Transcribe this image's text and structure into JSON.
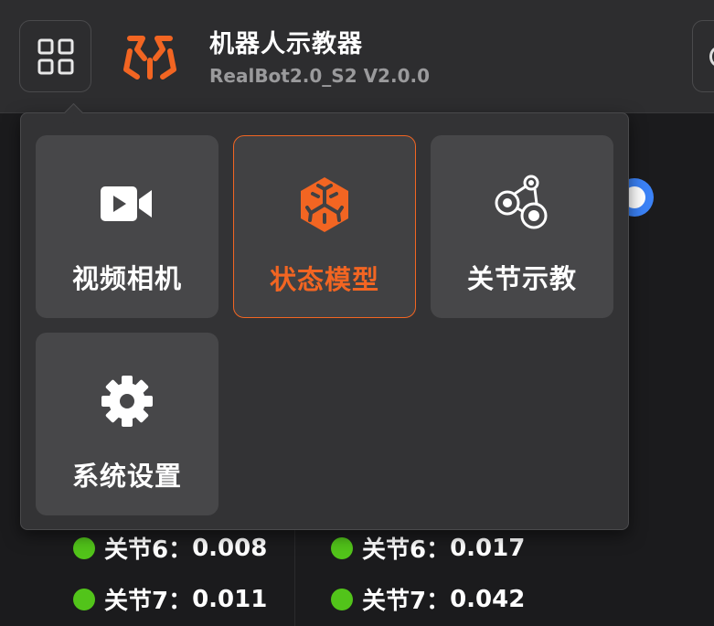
{
  "header": {
    "title": "机器人示教器",
    "subtitle": "RealBot2.0_S2 V2.0.0",
    "menu_icon": "grid-icon",
    "logo_icon": "robot-logo",
    "accent_color": "#f26522"
  },
  "app_menu": {
    "items": [
      {
        "label": "视频相机",
        "icon": "video-camera-icon",
        "active": false
      },
      {
        "label": "状态模型",
        "icon": "cube-model-icon",
        "active": true
      },
      {
        "label": "关节示教",
        "icon": "robot-arm-joint-icon",
        "active": false
      },
      {
        "label": "系统设置",
        "icon": "gear-icon",
        "active": false
      }
    ]
  },
  "joints": {
    "left": [
      {
        "label": "关节6：",
        "value": "0.008"
      },
      {
        "label": "关节7：",
        "value": "0.011"
      }
    ],
    "right": [
      {
        "label": "关节6：",
        "value": "0.017"
      },
      {
        "label": "关节7：",
        "value": "0.042"
      }
    ],
    "status_color": "#52c41a"
  }
}
